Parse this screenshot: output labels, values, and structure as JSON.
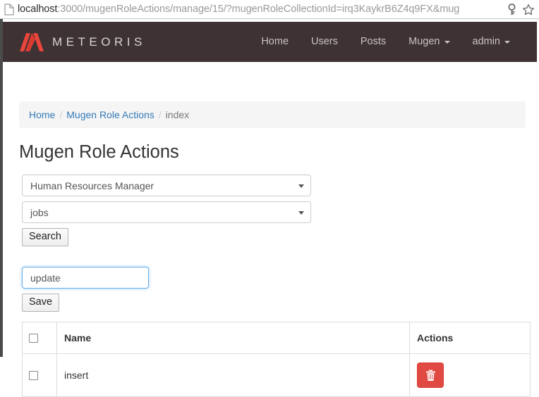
{
  "browser": {
    "url_host": "localhost",
    "url_rest": ":3000/mugenRoleActions/manage/15/?mugenRoleCollectionId=irq3KaykrB6Z4q9FX&mug",
    "page_icon": "page-document-icon",
    "key_icon": "key-icon",
    "bookmark_icon": "star-icon"
  },
  "navbar": {
    "brand": "METEORIS",
    "brand_mark": "meteoris-m-logo",
    "background": "#3E3234",
    "links": [
      {
        "label": "Home",
        "dropdown": false
      },
      {
        "label": "Users",
        "dropdown": false
      },
      {
        "label": "Posts",
        "dropdown": false
      },
      {
        "label": "Mugen",
        "dropdown": true
      },
      {
        "label": "admin",
        "dropdown": true
      }
    ]
  },
  "breadcrumb": {
    "items": [
      {
        "label": "Home",
        "link": true
      },
      {
        "label": "Mugen Role Actions",
        "link": true
      },
      {
        "label": "index",
        "link": false
      }
    ],
    "separator": "/"
  },
  "page": {
    "title": "Mugen Role Actions"
  },
  "search_form": {
    "role_select": {
      "value": "Human Resources Manager",
      "caret_icon": "chevron-down-icon"
    },
    "collection_select": {
      "value": "jobs",
      "caret_icon": "chevron-down-icon"
    },
    "search_button": "Search"
  },
  "create_form": {
    "name_input_value": "update",
    "name_input_placeholder": "",
    "save_button": "Save"
  },
  "table": {
    "columns": [
      "",
      "Name",
      "Actions"
    ],
    "rows": [
      {
        "name": "insert",
        "delete_icon": "trash-icon"
      }
    ]
  },
  "colors": {
    "navbar_bg": "#3E3234",
    "brand_red": "#E04A42",
    "link_blue": "#337AB7",
    "danger_red": "#E04A42",
    "focus_blue": "#66AFE9"
  }
}
